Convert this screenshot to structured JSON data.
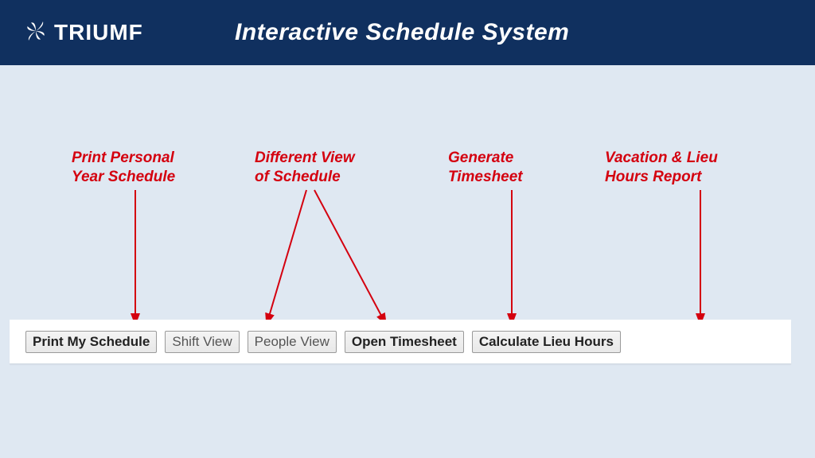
{
  "header": {
    "brand": "TRIUMF",
    "title": "Interactive Schedule System"
  },
  "annotations": {
    "print": "Print Personal\nYear Schedule",
    "views": "Different View\nof Schedule",
    "timesheet": "Generate\nTimesheet",
    "lieu": "Vacation & Lieu\nHours Report"
  },
  "buttons": {
    "print_my_schedule": "Print My Schedule",
    "shift_view": "Shift View",
    "people_view": "People View",
    "open_timesheet": "Open Timesheet",
    "calculate_lieu": "Calculate Lieu Hours"
  },
  "colors": {
    "header_bg": "#10305f",
    "body_bg": "#dfe8f2",
    "annotation": "#d4000f"
  }
}
